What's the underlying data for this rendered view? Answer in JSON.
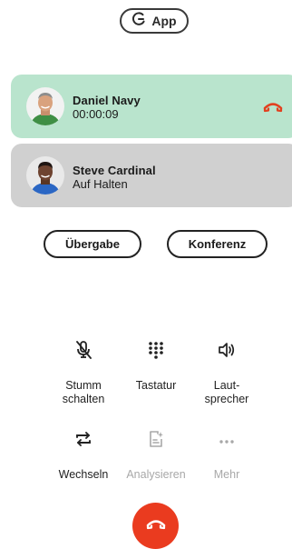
{
  "header": {
    "app_label": "App",
    "app_icon": "moon-g-icon"
  },
  "calls": {
    "active": {
      "name": "Daniel Navy",
      "status": "00:00:09",
      "hangup_icon": "hangup-icon"
    },
    "on_hold": {
      "name": "Steve Cardinal",
      "status": "Auf Halten"
    }
  },
  "buttons": {
    "transfer": "Übergabe",
    "conference": "Konferenz"
  },
  "actions": {
    "mute": "Stumm\nschalten",
    "keypad": "Tastatur",
    "speaker": "Laut-\nsprecher",
    "switch": "Wechseln",
    "analyze": "Analysieren",
    "more": "Mehr"
  },
  "colors": {
    "active_card": "#b9e4cd",
    "hold_card": "#d0d0d0",
    "hangup_red": "#ea3b1f",
    "disabled_text": "#a8a8a8"
  }
}
